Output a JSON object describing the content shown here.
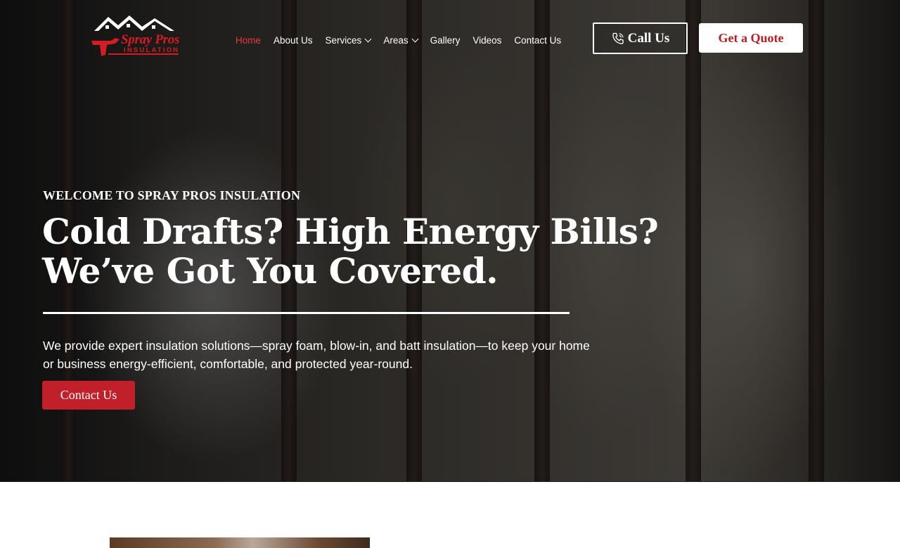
{
  "brand": {
    "name": "Spray Pros",
    "sub": "INSULATION",
    "accent": "#d41c22"
  },
  "nav": {
    "items": [
      {
        "label": "Home",
        "active": true
      },
      {
        "label": "About Us"
      },
      {
        "label": "Services",
        "dropdown": true
      },
      {
        "label": "Areas",
        "dropdown": true
      },
      {
        "label": "Gallery"
      },
      {
        "label": "Videos"
      },
      {
        "label": "Contact Us"
      }
    ]
  },
  "header": {
    "call_label": "Call Us",
    "call_icon": "phone-icon",
    "quote_label": "Get a Quote"
  },
  "hero": {
    "eyebrow": "WELCOME TO SPRAY PROS INSULATION",
    "headline_line1": "Cold Drafts? High Energy Bills?",
    "headline_line2": "We’ve Got You Covered.",
    "subtext": "We provide expert insulation solutions—spray foam, blow-in, and batt insulation—to keep your home or business energy-efficient, comfortable, and protected year-round.",
    "cta_label": "Contact Us"
  },
  "colors": {
    "primary_red": "#c1202a",
    "active_nav": "#e63b3b"
  }
}
